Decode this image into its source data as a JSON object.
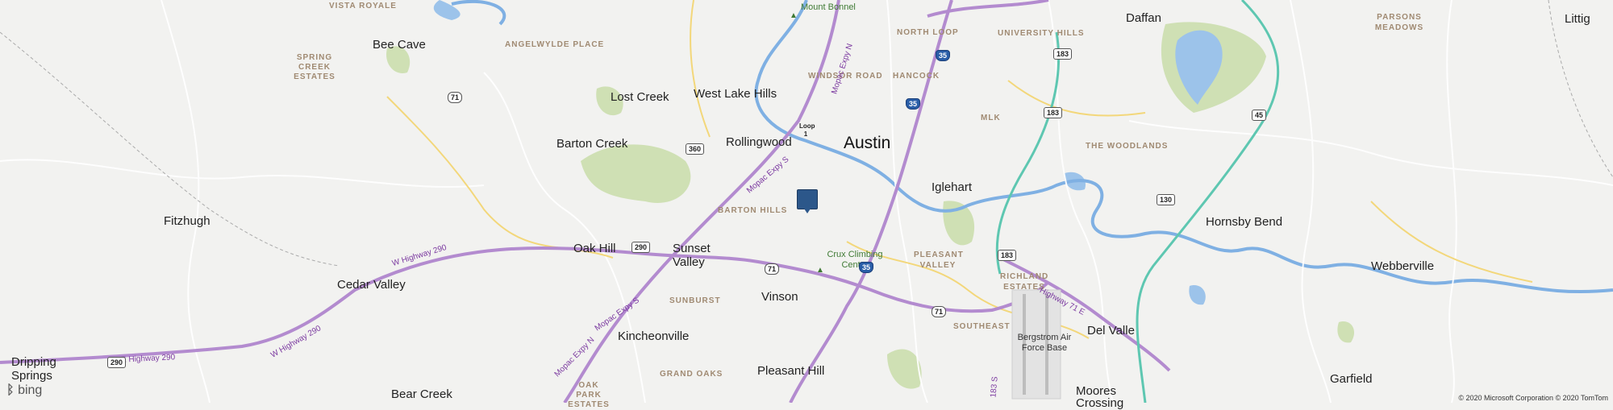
{
  "map": {
    "provider_logo": "bing",
    "copyright": "© 2020 Microsoft Corporation © 2020 TomTom",
    "marker": "location-pin"
  },
  "cities": {
    "austin": "Austin",
    "bee_cave": "Bee Cave",
    "lost_creek": "Lost Creek",
    "west_lake_hills": "West Lake Hills",
    "rollingwood": "Rollingwood",
    "barton_creek": "Barton Creek",
    "fitzhugh": "Fitzhugh",
    "oak_hill": "Oak Hill",
    "sunset_valley": "Sunset Valley",
    "cedar_valley": "Cedar Valley",
    "vinson": "Vinson",
    "kincheonville": "Kincheonville",
    "pleasant_hill": "Pleasant Hill",
    "dripping_springs": "Dripping Springs",
    "bear_creek": "Bear Creek",
    "iglehart": "Iglehart",
    "daffan": "Daffan",
    "littig": "Littig",
    "hornsby_bend": "Hornsby Bend",
    "webberville": "Webberville",
    "del_valle": "Del Valle",
    "garfield": "Garfield",
    "moores_crossing": "Moores Crossing"
  },
  "districts": {
    "vista_royale": "VISTA ROYALE",
    "spring_creek_estates": "SPRING CREEK ESTATES",
    "angelwylde_place": "ANGELWYLDE PLACE",
    "north_loop": "NORTH LOOP",
    "university_hills": "UNIVERSITY HILLS",
    "parsons_meadows": "PARSONS MEADOWS",
    "windsor_road": "WINDSOR ROAD",
    "hancock": "HANCOCK",
    "mlk": "MLK",
    "the_woodlands": "THE WOODLANDS",
    "barton_hills": "BARTON HILLS",
    "pleasant_valley": "PLEASANT VALLEY",
    "richland_estates": "RICHLAND ESTATES",
    "sunburst": "SUNBURST",
    "southeast": "SOUTHEAST",
    "grand_oaks": "GRAND OAKS",
    "oak_park_estates": "OAK PARK ESTATES"
  },
  "pois": {
    "mount_bonnel": "Mount Bonnel",
    "crux_climbing": "Crux Climbing Center",
    "bergstrom": "Bergstrom Air Force Base"
  },
  "roads": {
    "mopac_n": "Mopac Expy N",
    "mopac_s": "Mopac Expy S",
    "mopac_s2": "Mopac Expy S",
    "mopac_n2": "Mopac Expy N",
    "hwy290w": "W Highway 290",
    "hwy290w_2": "W Highway 290",
    "hwy290e": "E Highway 290",
    "hwy71e": "Highway 71 E",
    "hwy183s": "183 S"
  },
  "shields": {
    "i35_a": "35",
    "i35_b": "35",
    "i35_c": "35",
    "us183_a": "183",
    "us183_b": "183",
    "us183_c": "183",
    "sh71_a": "71",
    "sh71_b": "71",
    "sh71_c": "71",
    "us290_a": "290",
    "us290_b": "290",
    "loop1": "Loop 1",
    "rm360": "360",
    "sh130": "130",
    "sh45": "45"
  }
}
